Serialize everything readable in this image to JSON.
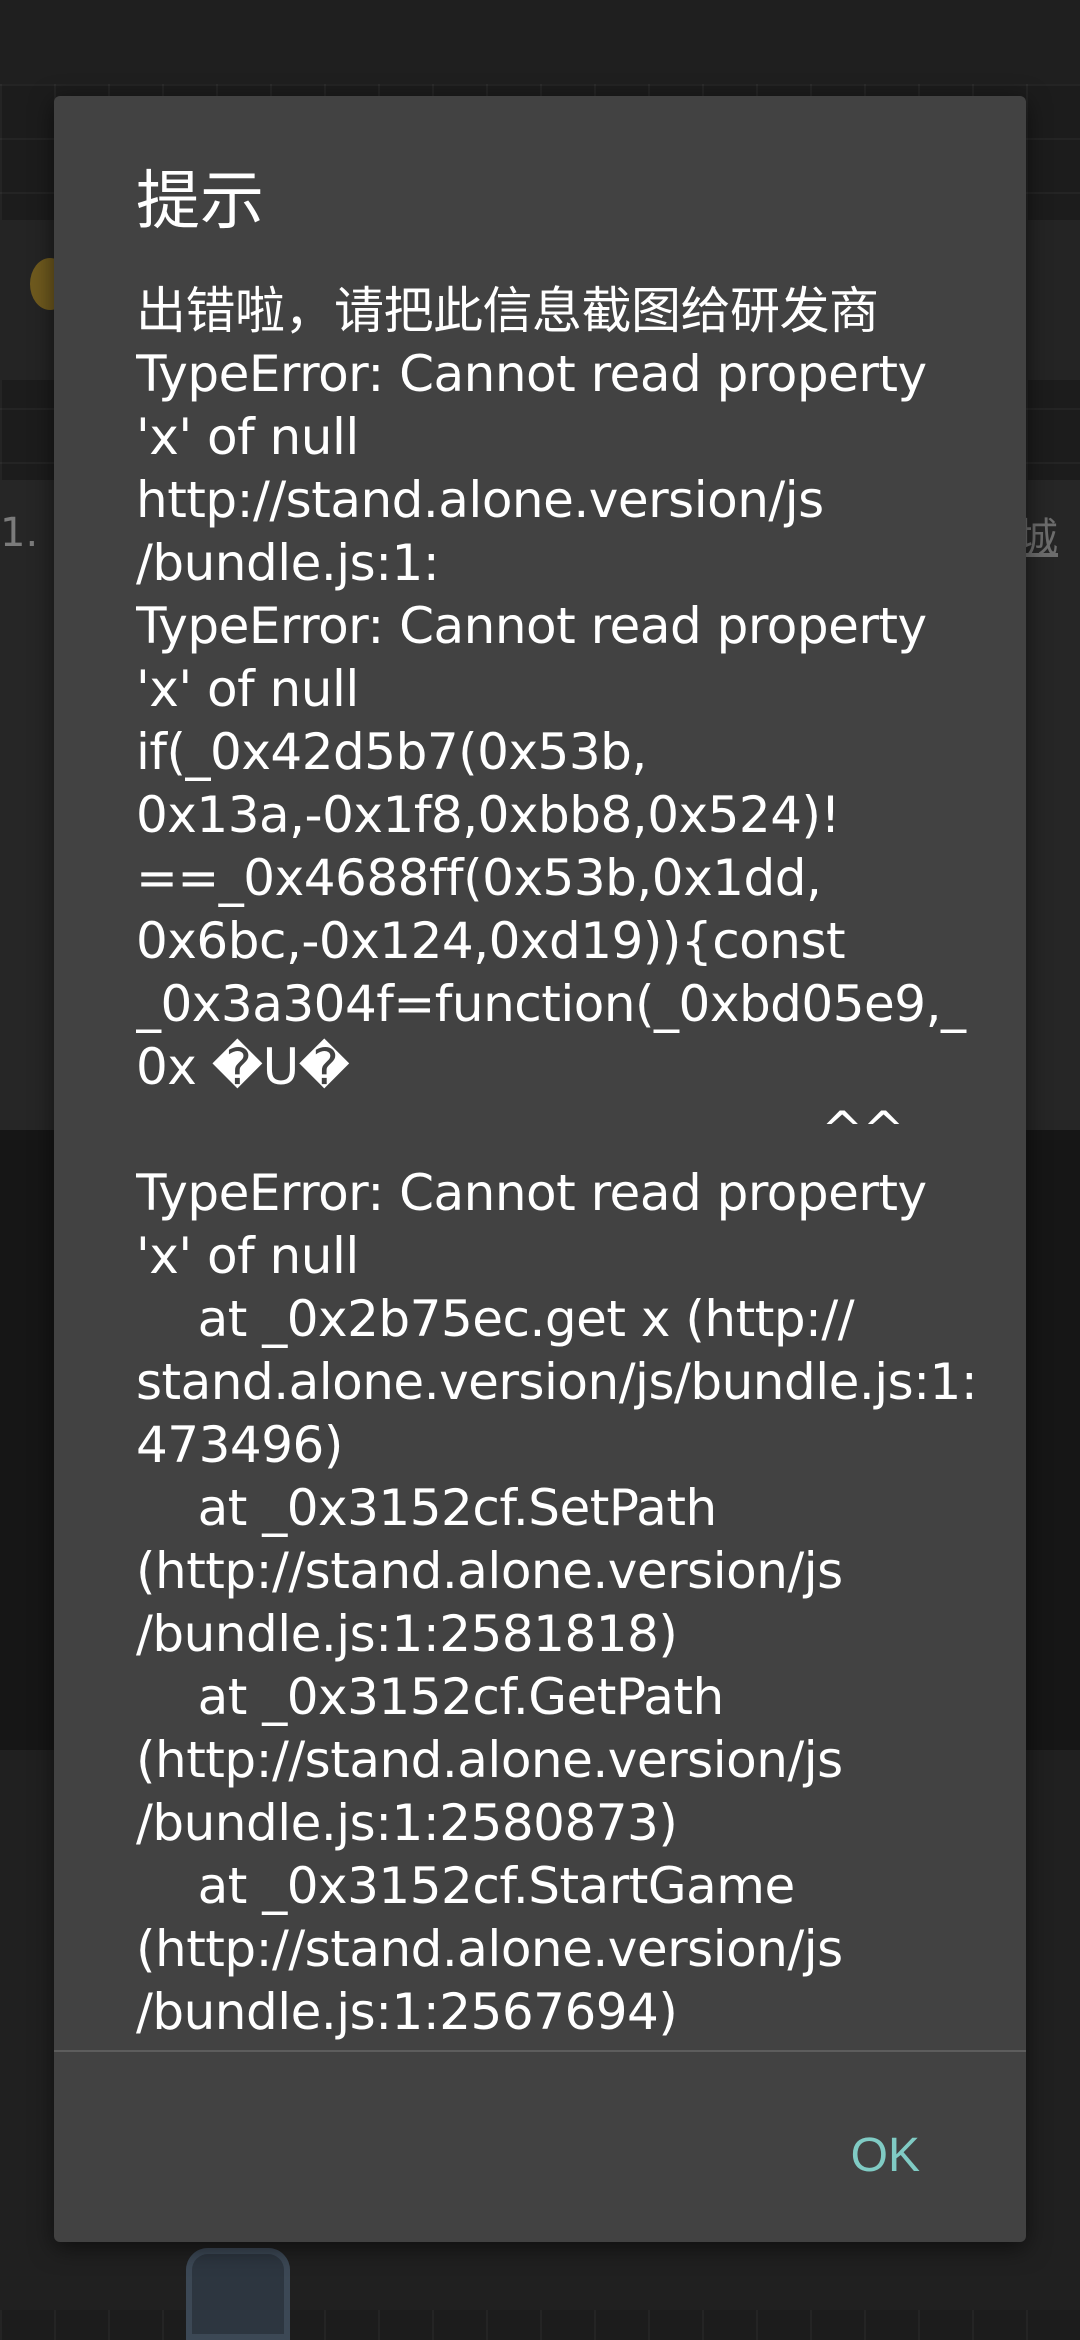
{
  "background": {
    "side_number": "1.",
    "side_glyph": "城"
  },
  "dialog": {
    "title": "提示",
    "message_lines": [
      "出错啦，请把此信息截图给研发商",
      "TypeError: Cannot read property",
      "'x' of null",
      "http://stand.alone.version/js",
      "/bundle.js:1:",
      "TypeError: Cannot read property",
      "'x' of null",
      "if(_0x42d5b7(0x53b,",
      "0x13a,-0x1f8,0xbb8,0x524)!",
      "==_0x4688ff(0x53b,0x1dd,",
      "0x6bc,-0x124,0xd19)){const",
      "_0x3a304f=function(_0xbd05e9,_",
      "0x �U�",
      "^^",
      "TypeError: Cannot read property",
      "'x' of null",
      "    at _0x2b75ec.get x (http://",
      "stand.alone.version/js/bundle.js:1:",
      "473496)",
      "    at _0x3152cf.SetPath",
      "(http://stand.alone.version/js",
      "/bundle.js:1:2581818)",
      "    at _0x3152cf.GetPath",
      "(http://stand.alone.version/js",
      "/bundle.js:1:2580873)",
      "    at _0x3152cf.StartGame",
      "(http://stand.alone.version/js",
      "/bundle.js:1:2567694)"
    ],
    "ok_label": "OK"
  },
  "colors": {
    "dialog_background": "#424242",
    "accent": "#80cbc4",
    "text": "#ffffff"
  }
}
